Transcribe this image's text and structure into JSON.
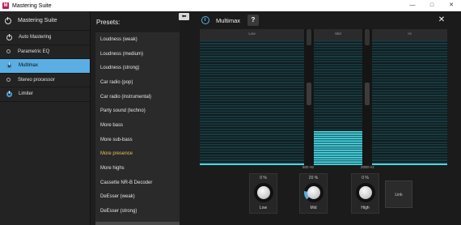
{
  "window": {
    "title": "Mastering Suite",
    "app_icon": "m-app-icon",
    "controls": [
      "minimize",
      "maximize",
      "close"
    ]
  },
  "left_panel": {
    "header": "Mastering Suite",
    "items": [
      {
        "label": "Auto Mastering",
        "icon": "power-icon",
        "active": false
      },
      {
        "label": "Parametric EQ",
        "icon": "dot-icon",
        "active": false
      },
      {
        "label": "Multimax",
        "icon": "power-icon",
        "active": true
      },
      {
        "label": "Stereo processor",
        "icon": "dot-icon",
        "active": false
      },
      {
        "label": "Limiter",
        "icon": "power-icon",
        "active": false
      }
    ]
  },
  "presets": {
    "label": "Presets:",
    "items": [
      "Loudness (weak)",
      "Loudness (medium)",
      "Loudness (strong)",
      "Car radio (pop)",
      "Car radio (instrumental)",
      "Party sound (techno)",
      "More bass",
      "More sub-bass",
      "More presence",
      "More highs",
      "Cassette NR-B Decoder",
      "DeEsser (weak)",
      "DeEsser (strong)"
    ],
    "highlighted": "More presence"
  },
  "back_button": "⬅",
  "main": {
    "title": "Multimax",
    "help_label": "?",
    "close_label": "✕",
    "bands": [
      {
        "name": "Low",
        "level": 0.02
      },
      {
        "name": "Mid",
        "level": 0.25
      },
      {
        "name": "Hi",
        "level": 0.02
      }
    ],
    "crossovers": [
      "500 Hz",
      "2000 Hz"
    ],
    "knobs": [
      {
        "value": "0 %",
        "name": "Low"
      },
      {
        "value": "20 %",
        "name": "Mid"
      },
      {
        "value": "0 %",
        "name": "High"
      }
    ],
    "link_label": "Link"
  },
  "colors": {
    "accent": "#5aaee3",
    "meter": "#52d9e6",
    "highlight_text": "#e8c15a"
  }
}
